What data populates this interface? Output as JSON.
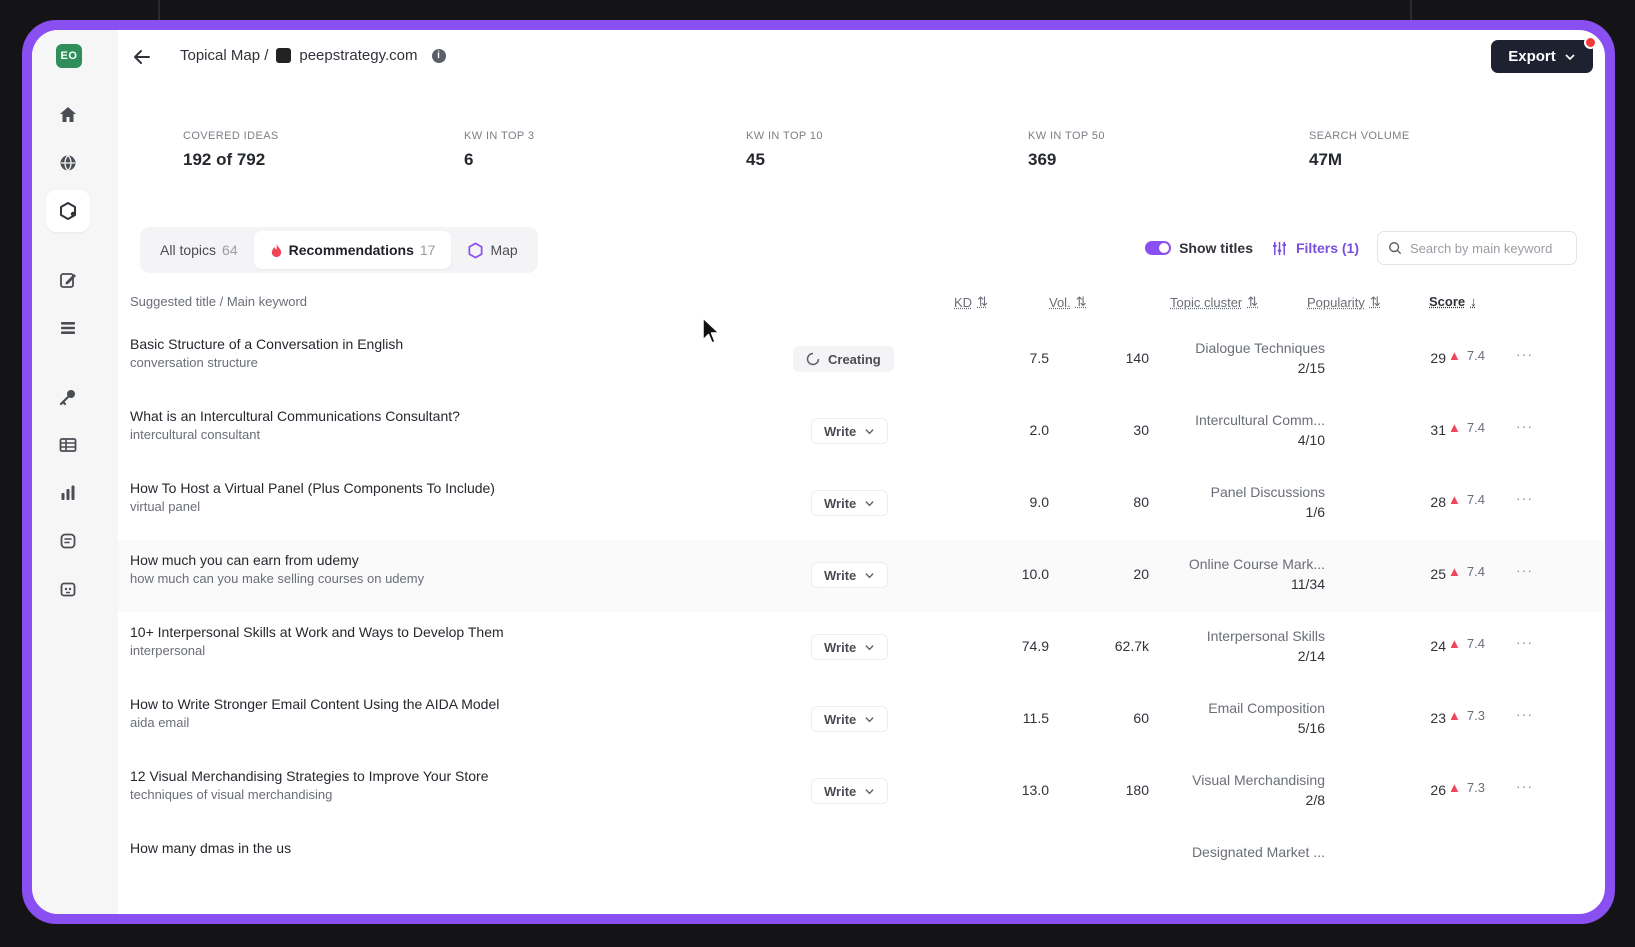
{
  "sidebar": {
    "workspace_initials": "EO",
    "icons": [
      "home-icon",
      "globe-icon",
      "topical-map-icon",
      "edit-icon",
      "list-icon",
      "key-icon",
      "table-icon",
      "bar-chart-icon",
      "doc-icon",
      "ai-assistant-icon"
    ]
  },
  "header": {
    "crumb_root": "Topical Map /",
    "site": "peepstrategy.com",
    "export_label": "Export"
  },
  "stats": [
    {
      "label": "COVERED IDEAS",
      "value": "192 of 792"
    },
    {
      "label": "KW IN TOP 3",
      "value": "6"
    },
    {
      "label": "KW IN TOP 10",
      "value": "45"
    },
    {
      "label": "KW IN TOP 50",
      "value": "369"
    },
    {
      "label": "SEARCH VOLUME",
      "value": "47M"
    }
  ],
  "tabs": [
    {
      "label": "All topics",
      "count": "64"
    },
    {
      "label": "Recommendations",
      "count": "17"
    },
    {
      "label": "Map",
      "count": ""
    }
  ],
  "toolbar": {
    "show_titles": "Show titles",
    "filters": "Filters (1)",
    "search_placeholder": "Search by main keyword"
  },
  "columns": {
    "title": "Suggested title / Main keyword",
    "kd": "KD",
    "vol": "Vol.",
    "cluster": "Topic cluster",
    "popularity": "Popularity",
    "score": "Score"
  },
  "rows": [
    {
      "title": "Basic Structure of a Conversation in English",
      "keyword": "conversation structure",
      "action": "Creating",
      "kd": "7.5",
      "vol": "140",
      "cluster": "Dialogue Techniques",
      "cluster_frac": "2/15",
      "popularity": "29",
      "score": "7.4"
    },
    {
      "title": "What is an Intercultural Communications Consultant?",
      "keyword": "intercultural consultant",
      "action": "Write",
      "kd": "2.0",
      "vol": "30",
      "cluster": "Intercultural Comm...",
      "cluster_frac": "4/10",
      "popularity": "31",
      "score": "7.4"
    },
    {
      "title": "How To Host a Virtual Panel (Plus Components To Include)",
      "keyword": "virtual panel",
      "action": "Write",
      "kd": "9.0",
      "vol": "80",
      "cluster": "Panel Discussions",
      "cluster_frac": "1/6",
      "popularity": "28",
      "score": "7.4"
    },
    {
      "title": "How much you can earn from udemy",
      "keyword": "how much can you make selling courses on udemy",
      "action": "Write",
      "kd": "10.0",
      "vol": "20",
      "cluster": "Online Course Mark...",
      "cluster_frac": "11/34",
      "popularity": "25",
      "score": "7.4"
    },
    {
      "title": "10+ Interpersonal Skills at Work and Ways to Develop Them",
      "keyword": "interpersonal",
      "action": "Write",
      "kd": "74.9",
      "vol": "62.7k",
      "cluster": "Interpersonal Skills",
      "cluster_frac": "2/14",
      "popularity": "24",
      "score": "7.4"
    },
    {
      "title": "How to Write Stronger Email Content Using the AIDA Model",
      "keyword": "aida email",
      "action": "Write",
      "kd": "11.5",
      "vol": "60",
      "cluster": "Email Composition",
      "cluster_frac": "5/16",
      "popularity": "23",
      "score": "7.3"
    },
    {
      "title": "12 Visual Merchandising Strategies to Improve Your Store",
      "keyword": "techniques of visual merchandising",
      "action": "Write",
      "kd": "13.0",
      "vol": "180",
      "cluster": "Visual Merchandising",
      "cluster_frac": "2/8",
      "popularity": "26",
      "score": "7.3"
    },
    {
      "title": "How many dmas in the us",
      "keyword": "",
      "action": "",
      "kd": "",
      "vol": "",
      "cluster": "Designated Market ...",
      "cluster_frac": "",
      "popularity": "",
      "score": ""
    }
  ]
}
